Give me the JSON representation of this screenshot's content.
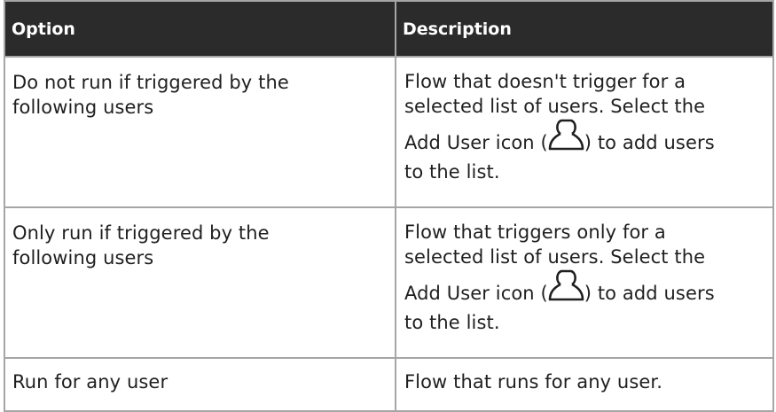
{
  "table": {
    "headers": {
      "option": "Option",
      "description": "Description"
    },
    "rows": [
      {
        "option_lines": [
          "Do not run if triggered by the",
          "following users"
        ],
        "desc_lines": [
          "Flow that doesn't trigger for a",
          "selected list of users. Select the"
        ],
        "desc_icon_before": "Add User icon (",
        "desc_icon_after": ") to add users",
        "desc_last": "to the list.",
        "icon": "add-user-icon"
      },
      {
        "option_lines": [
          "Only run if triggered by the",
          "following users"
        ],
        "desc_lines": [
          "Flow that triggers only for a",
          "selected list of users. Select the"
        ],
        "desc_icon_before": "Add User icon (",
        "desc_icon_after": ") to add users",
        "desc_last": "to the list.",
        "icon": "add-user-icon"
      },
      {
        "option": "Run for any user",
        "description": "Flow that runs for any user."
      }
    ]
  }
}
